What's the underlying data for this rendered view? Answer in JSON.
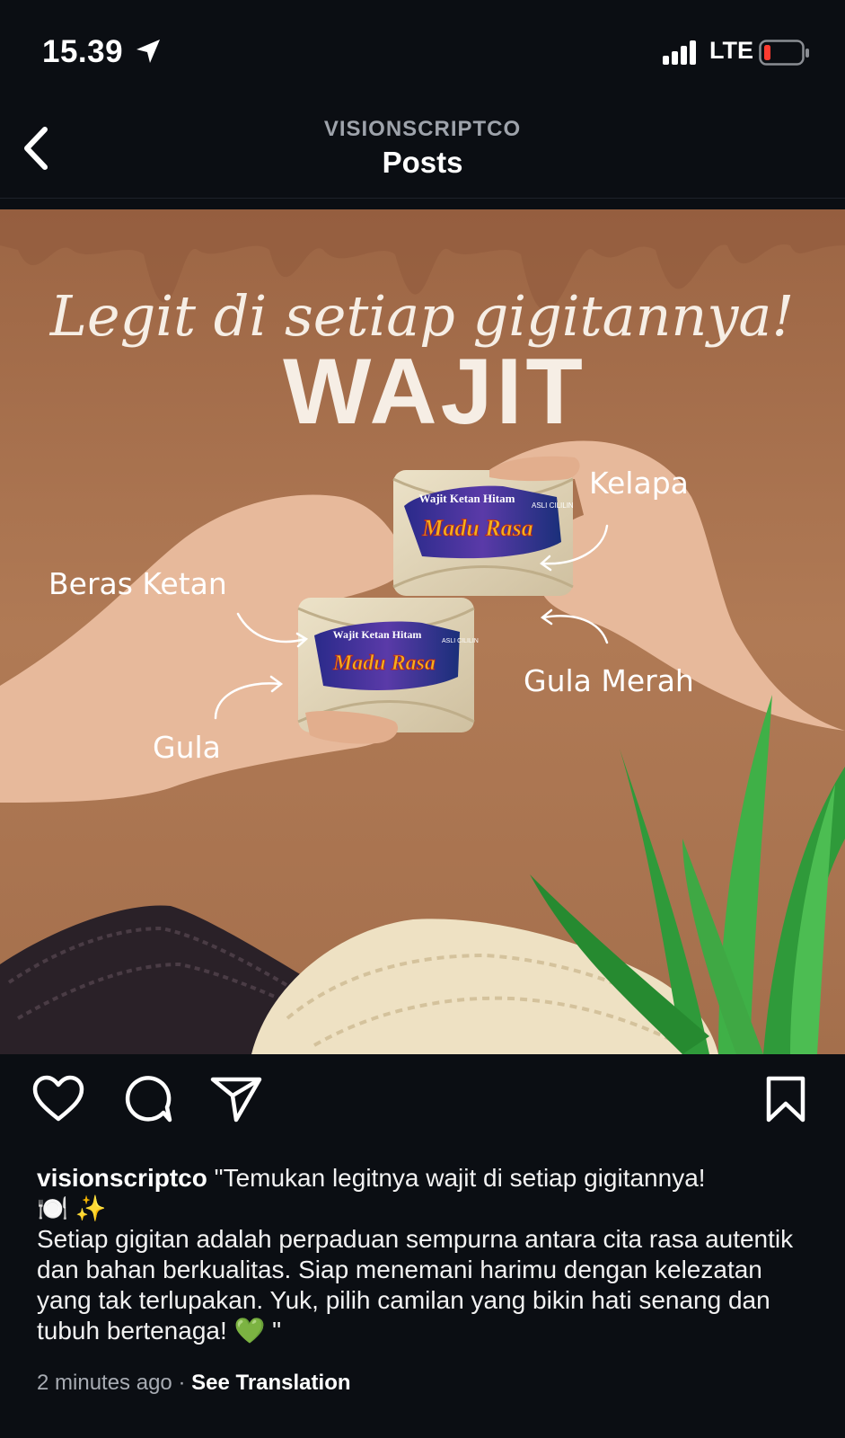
{
  "status_bar": {
    "time": "15.39",
    "network": "LTE"
  },
  "header": {
    "account": "VISIONSCRIPTCO",
    "title": "Posts"
  },
  "post_image": {
    "script_text": "Legit di setiap gigitannya!",
    "headline": "WAJIT",
    "labels": {
      "kelapa": "Kelapa",
      "beras_ketan": "Beras Ketan",
      "gula_merah": "Gula Merah",
      "gula": "Gula"
    },
    "package_text": {
      "line1": "Wajit Ketan Hitam",
      "brand": "Madu Rasa",
      "side": "ASLI CILILIN"
    }
  },
  "actions": {
    "like": "heart-icon",
    "comment": "comment-icon",
    "share": "share-icon",
    "save": "bookmark-icon"
  },
  "caption": {
    "username": "visionscriptco",
    "text_line1": "\"Temukan legitnya wajit di setiap gigitannya!",
    "emoji_line": "🍽️ ✨",
    "body": "Setiap gigitan adalah perpaduan sempurna antara cita rasa autentik dan bahan berkualitas. Siap menemani harimu dengan kelezatan yang tak terlupakan. Yuk, pilih camilan yang bikin hati senang dan tubuh bertenaga! 💚 \""
  },
  "meta": {
    "time_ago": "2 minutes ago",
    "separator": "·",
    "see_translation": "See Translation"
  },
  "colors": {
    "background": "#0b0e13",
    "post_bg": "#a9714c",
    "label": "#ffffff",
    "muted": "#9ea3ab"
  }
}
